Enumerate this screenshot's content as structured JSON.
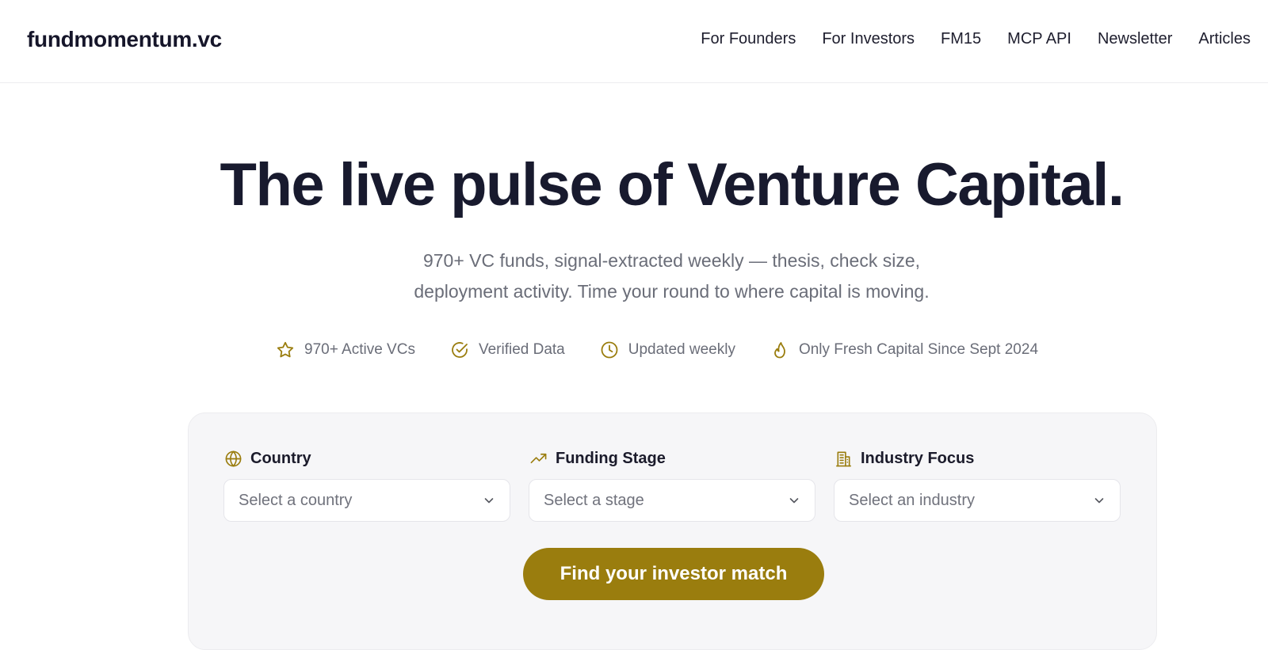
{
  "header": {
    "logo": "fundmomentum.vc",
    "nav": [
      {
        "label": "For Founders"
      },
      {
        "label": "For Investors"
      },
      {
        "label": "FM15"
      },
      {
        "label": "MCP API"
      },
      {
        "label": "Newsletter"
      },
      {
        "label": "Articles"
      }
    ]
  },
  "hero": {
    "title": "The live pulse of Venture Capital.",
    "subtitle_line1": "970+ VC funds, signal-extracted weekly — thesis, check size,",
    "subtitle_line2": "deployment activity. Time your round to where capital is moving."
  },
  "features": [
    {
      "icon": "star-icon",
      "label": "970+ Active VCs"
    },
    {
      "icon": "check-circle-icon",
      "label": "Verified Data"
    },
    {
      "icon": "clock-icon",
      "label": "Updated weekly"
    },
    {
      "icon": "flame-icon",
      "label": "Only Fresh Capital Since Sept 2024"
    }
  ],
  "search": {
    "country": {
      "icon": "globe-icon",
      "label": "Country",
      "placeholder": "Select a country"
    },
    "stage": {
      "icon": "trending-up-icon",
      "label": "Funding Stage",
      "placeholder": "Select a stage"
    },
    "industry": {
      "icon": "building-icon",
      "label": "Industry Focus",
      "placeholder": "Select an industry"
    },
    "cta_label": "Find your investor match"
  },
  "colors": {
    "accent": "#9a7d0e",
    "heading": "#181a2e",
    "muted_text": "#6a6d78",
    "panel_background": "#f6f6f8"
  }
}
